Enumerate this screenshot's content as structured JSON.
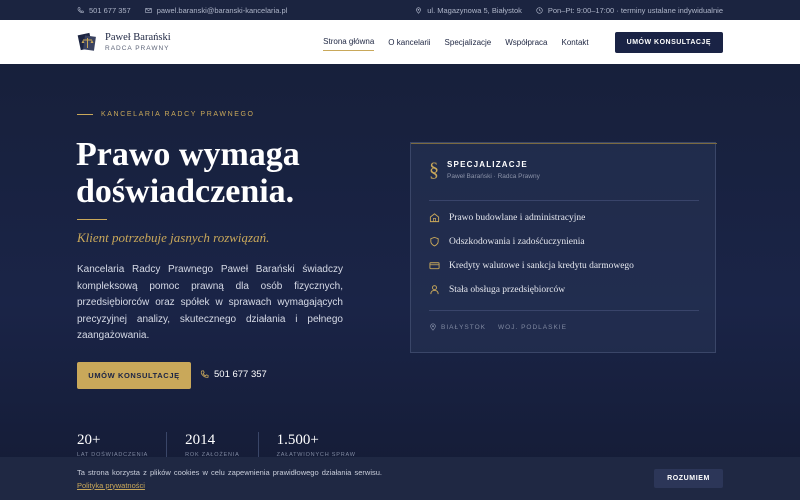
{
  "topbar": {
    "phone": "501 677 357",
    "email": "pawel.baranski@baranski-kancelaria.pl",
    "address": "ul. Magazynowa 5, Białystok",
    "hours": "Pon–Pt: 9:00–17:00 · terminy ustalane indywidualnie"
  },
  "nav": {
    "logo_name": "Paweł Barański",
    "logo_role": "RADCA PRAWNY",
    "items": [
      {
        "label": "Strona główna",
        "active": true
      },
      {
        "label": "O kancelarii"
      },
      {
        "label": "Specjalizacje"
      },
      {
        "label": "Współpraca"
      },
      {
        "label": "Kontakt"
      }
    ],
    "cta": "UMÓW KONSULTACJĘ"
  },
  "hero": {
    "eyebrow": "KANCELARIA RADCY PRAWNEGO",
    "headline_line1": "Prawo wymaga",
    "headline_line2": "doświadczenia.",
    "lead": "Klient potrzebuje jasnych rozwiązań.",
    "description": "Kancelaria Radcy Prawnego Paweł Barański świadczy kompleksową pomoc prawną dla osób fizycznych, przedsiębiorców oraz spółek w sprawach wymagających precyzyjnej analizy, skutecznego działania i pełnego zaangażowania.",
    "cta": "UMÓW KONSULTACJĘ",
    "phone": "501 677 357"
  },
  "card": {
    "symbol": "§",
    "title": "SPECJALIZACJE",
    "subtitle": "Paweł Barański · Radca Prawny",
    "items": [
      {
        "label": "Prawo budowlane i administracyjne",
        "icon": "building-icon"
      },
      {
        "label": "Odszkodowania i zadośćuczynienia",
        "icon": "shield-icon"
      },
      {
        "label": "Kredyty walutowe i sankcja kredytu darmowego",
        "icon": "credit-card-icon"
      },
      {
        "label": "Stała obsługa przedsiębiorców",
        "icon": "user-icon"
      }
    ],
    "city": "BIAŁYSTOK",
    "region": "WOJ. PODLASKIE"
  },
  "stats": [
    {
      "value": "20+",
      "label": "LAT DOŚWIADCZENIA"
    },
    {
      "value": "2014",
      "label": "ROK ZAŁOŻENIA"
    },
    {
      "value": "1.500+",
      "label": "ZAŁATWIONYCH SPRAW"
    }
  ],
  "cookie": {
    "text": "Ta strona korzysta z plików cookies w celu zapewnienia prawidłowego działania serwisu.",
    "link": "Polityka prywatności",
    "button": "ROZUMIEM"
  },
  "colors": {
    "navy": "#1a2345",
    "gold": "#c9a85a",
    "white": "#ffffff"
  }
}
